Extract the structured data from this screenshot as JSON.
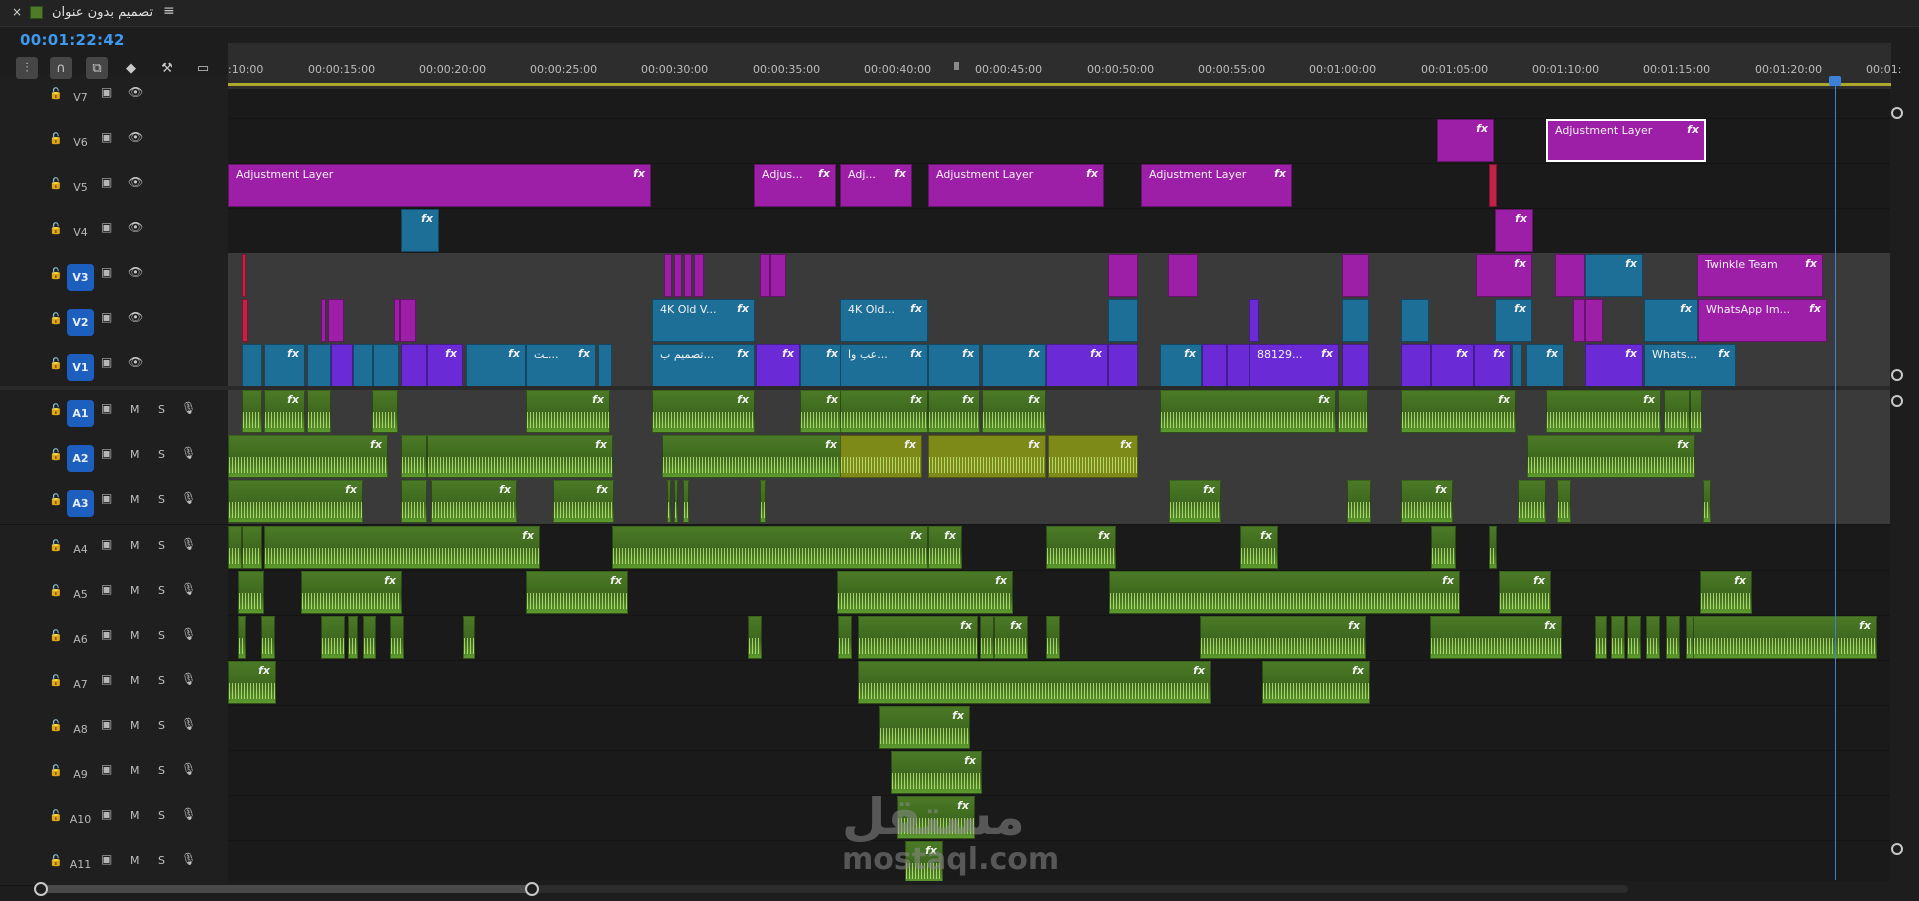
{
  "panel": {
    "close_symbol": "×",
    "title": "تصميم بدون عنوان",
    "menu_symbol": "≡",
    "timecode": "00:01:22:42"
  },
  "toolbar": [
    {
      "name": "insert-sequence-tool",
      "glyph": "⫶",
      "on": true
    },
    {
      "name": "snap-magnet-tool",
      "glyph": "∩",
      "on": true
    },
    {
      "name": "linked-selection-tool",
      "glyph": "⧉",
      "on": true
    },
    {
      "name": "add-marker-tool",
      "glyph": "◆",
      "on": false
    },
    {
      "name": "wrench-settings-tool",
      "glyph": "⚒",
      "on": false
    },
    {
      "name": "captions-tool",
      "glyph": "▭",
      "on": false
    }
  ],
  "ruler": {
    "ticks": [
      ":10:00",
      "00:00:15:00",
      "00:00:20:00",
      "00:00:25:00",
      "00:00:30:00",
      "00:00:35:00",
      "00:00:40:00",
      "00:00:45:00",
      "00:00:50:00",
      "00:00:55:00",
      "00:01:00:00",
      "00:01:05:00",
      "00:01:10:00",
      "00:01:15:00",
      "00:01:20:00",
      "00:01:"
    ]
  },
  "video_tracks": [
    {
      "id": "V7",
      "targeted": false
    },
    {
      "id": "V6",
      "targeted": false
    },
    {
      "id": "V5",
      "targeted": false
    },
    {
      "id": "V4",
      "targeted": false
    },
    {
      "id": "V3",
      "targeted": true
    },
    {
      "id": "V2",
      "targeted": true
    },
    {
      "id": "V1",
      "targeted": true
    }
  ],
  "audio_tracks": [
    {
      "id": "A1",
      "targeted": true
    },
    {
      "id": "A2",
      "targeted": true
    },
    {
      "id": "A3",
      "targeted": true
    },
    {
      "id": "A4",
      "targeted": false
    },
    {
      "id": "A5",
      "targeted": false
    },
    {
      "id": "A6",
      "targeted": false
    },
    {
      "id": "A7",
      "targeted": false
    },
    {
      "id": "A8",
      "targeted": false
    },
    {
      "id": "A9",
      "targeted": false
    },
    {
      "id": "A10",
      "targeted": false
    },
    {
      "id": "A11",
      "targeted": false
    }
  ],
  "track_controls": {
    "mute": "M",
    "solo": "S"
  },
  "fx_label": "fx",
  "clips": {
    "V6": [
      {
        "label": "",
        "kind": "adj"
      },
      {
        "label": "Adjustment Layer",
        "kind": "adj",
        "selected": true
      }
    ],
    "V5": [
      {
        "label": "Adjustment Layer",
        "kind": "adj"
      },
      {
        "label": "Adjus...",
        "kind": "adj"
      },
      {
        "label": "Adj...",
        "kind": "adj"
      },
      {
        "label": "Adjustment Layer",
        "kind": "adj"
      },
      {
        "label": "Adjustment Layer",
        "kind": "adj"
      }
    ],
    "V2": [
      {
        "label": "4K Old V...",
        "kind": "vid"
      },
      {
        "label": "4K Old...",
        "kind": "vid"
      },
      {
        "label": "WhatsApp Im...",
        "kind": "adj"
      }
    ],
    "V3": [
      {
        "label": "Twinkle Team",
        "kind": "adj"
      }
    ],
    "V1": [
      {
        "label": "ـت...",
        "kind": "vid"
      },
      {
        "label": "تصميم ب...",
        "kind": "vid"
      },
      {
        "label": "عب وا...",
        "kind": "vid"
      },
      {
        "label": "88129...",
        "kind": "vio"
      },
      {
        "label": "Whats...",
        "kind": "vid"
      }
    ]
  },
  "watermark": {
    "arabic": "مستقل",
    "latin": "mostaql.com"
  }
}
